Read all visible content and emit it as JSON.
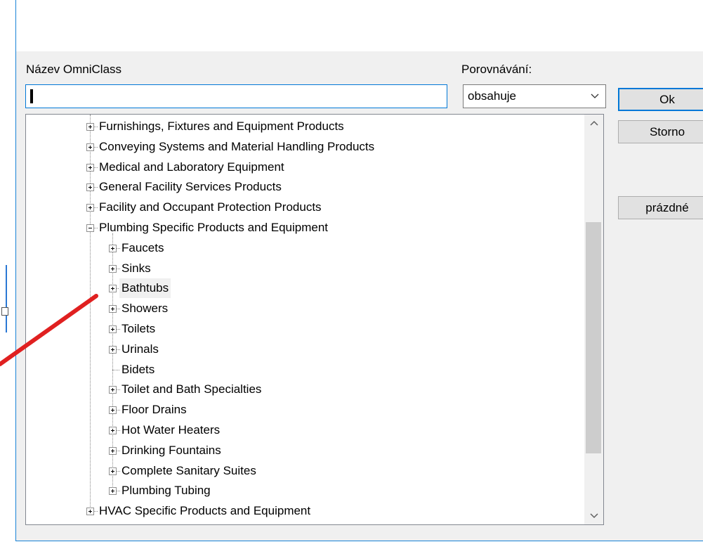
{
  "dialog": {
    "close_glyph": "✕",
    "name_label": "Název OmniClass",
    "compare_label": "Porovnávání:",
    "name_value": "",
    "compare_value": "obsahuje",
    "buttons": {
      "ok": "Ok",
      "cancel": "Storno",
      "empty": "prázdné"
    }
  },
  "tree": {
    "items": [
      {
        "label": "Furnishings, Fixtures and Equipment Products",
        "level": 0,
        "expanded": false
      },
      {
        "label": "Conveying Systems and Material Handling Products",
        "level": 0,
        "expanded": false
      },
      {
        "label": "Medical and Laboratory Equipment",
        "level": 0,
        "expanded": false
      },
      {
        "label": "General Facility Services Products",
        "level": 0,
        "expanded": false
      },
      {
        "label": "Facility and Occupant Protection Products",
        "level": 0,
        "expanded": false
      },
      {
        "label": "Plumbing Specific Products and Equipment",
        "level": 0,
        "expanded": true
      },
      {
        "label": "Faucets",
        "level": 1,
        "expanded": false
      },
      {
        "label": "Sinks",
        "level": 1,
        "expanded": false
      },
      {
        "label": "Bathtubs",
        "level": 1,
        "expanded": false,
        "selected": true
      },
      {
        "label": "Showers",
        "level": 1,
        "expanded": false
      },
      {
        "label": "Toilets",
        "level": 1,
        "expanded": false
      },
      {
        "label": "Urinals",
        "level": 1,
        "expanded": false
      },
      {
        "label": "Bidets",
        "level": 1,
        "leaf": true
      },
      {
        "label": "Toilet and Bath Specialties",
        "level": 1,
        "expanded": false
      },
      {
        "label": "Floor Drains",
        "level": 1,
        "expanded": false
      },
      {
        "label": "Hot Water Heaters",
        "level": 1,
        "expanded": false
      },
      {
        "label": "Drinking Fountains",
        "level": 1,
        "expanded": false
      },
      {
        "label": "Complete Sanitary Suites",
        "level": 1,
        "expanded": false
      },
      {
        "label": "Plumbing Tubing",
        "level": 1,
        "expanded": false
      },
      {
        "label": "HVAC Specific Products and Equipment",
        "level": 0,
        "expanded": false
      }
    ]
  },
  "colors": {
    "accent": "#0078d7",
    "annotation_arrow": "#e02020"
  },
  "icons": {
    "up": "chevron-up-icon",
    "down": "chevron-down-icon"
  }
}
